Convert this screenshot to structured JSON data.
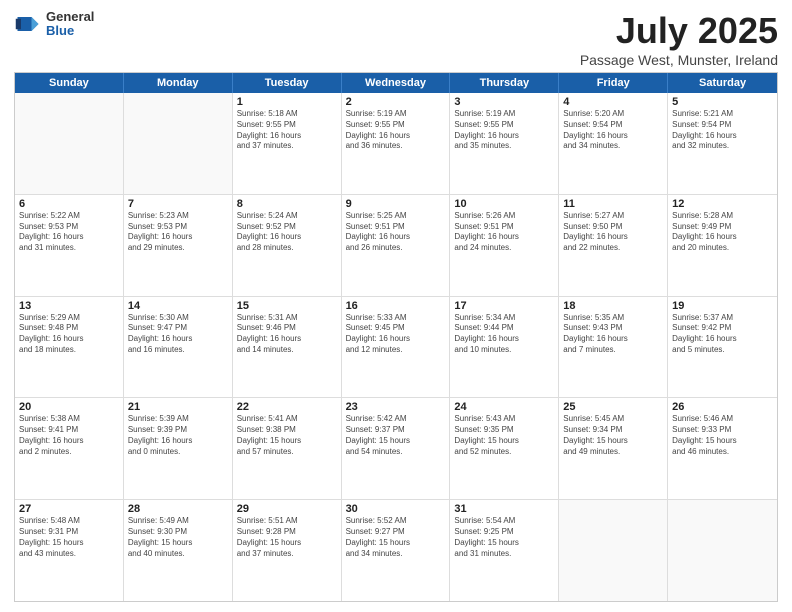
{
  "header": {
    "logo": {
      "general": "General",
      "blue": "Blue"
    },
    "title": "July 2025",
    "subtitle": "Passage West, Munster, Ireland"
  },
  "calendar": {
    "days": [
      "Sunday",
      "Monday",
      "Tuesday",
      "Wednesday",
      "Thursday",
      "Friday",
      "Saturday"
    ],
    "rows": [
      [
        {
          "num": "",
          "content": ""
        },
        {
          "num": "",
          "content": ""
        },
        {
          "num": "1",
          "content": "Sunrise: 5:18 AM\nSunset: 9:55 PM\nDaylight: 16 hours\nand 37 minutes."
        },
        {
          "num": "2",
          "content": "Sunrise: 5:19 AM\nSunset: 9:55 PM\nDaylight: 16 hours\nand 36 minutes."
        },
        {
          "num": "3",
          "content": "Sunrise: 5:19 AM\nSunset: 9:55 PM\nDaylight: 16 hours\nand 35 minutes."
        },
        {
          "num": "4",
          "content": "Sunrise: 5:20 AM\nSunset: 9:54 PM\nDaylight: 16 hours\nand 34 minutes."
        },
        {
          "num": "5",
          "content": "Sunrise: 5:21 AM\nSunset: 9:54 PM\nDaylight: 16 hours\nand 32 minutes."
        }
      ],
      [
        {
          "num": "6",
          "content": "Sunrise: 5:22 AM\nSunset: 9:53 PM\nDaylight: 16 hours\nand 31 minutes."
        },
        {
          "num": "7",
          "content": "Sunrise: 5:23 AM\nSunset: 9:53 PM\nDaylight: 16 hours\nand 29 minutes."
        },
        {
          "num": "8",
          "content": "Sunrise: 5:24 AM\nSunset: 9:52 PM\nDaylight: 16 hours\nand 28 minutes."
        },
        {
          "num": "9",
          "content": "Sunrise: 5:25 AM\nSunset: 9:51 PM\nDaylight: 16 hours\nand 26 minutes."
        },
        {
          "num": "10",
          "content": "Sunrise: 5:26 AM\nSunset: 9:51 PM\nDaylight: 16 hours\nand 24 minutes."
        },
        {
          "num": "11",
          "content": "Sunrise: 5:27 AM\nSunset: 9:50 PM\nDaylight: 16 hours\nand 22 minutes."
        },
        {
          "num": "12",
          "content": "Sunrise: 5:28 AM\nSunset: 9:49 PM\nDaylight: 16 hours\nand 20 minutes."
        }
      ],
      [
        {
          "num": "13",
          "content": "Sunrise: 5:29 AM\nSunset: 9:48 PM\nDaylight: 16 hours\nand 18 minutes."
        },
        {
          "num": "14",
          "content": "Sunrise: 5:30 AM\nSunset: 9:47 PM\nDaylight: 16 hours\nand 16 minutes."
        },
        {
          "num": "15",
          "content": "Sunrise: 5:31 AM\nSunset: 9:46 PM\nDaylight: 16 hours\nand 14 minutes."
        },
        {
          "num": "16",
          "content": "Sunrise: 5:33 AM\nSunset: 9:45 PM\nDaylight: 16 hours\nand 12 minutes."
        },
        {
          "num": "17",
          "content": "Sunrise: 5:34 AM\nSunset: 9:44 PM\nDaylight: 16 hours\nand 10 minutes."
        },
        {
          "num": "18",
          "content": "Sunrise: 5:35 AM\nSunset: 9:43 PM\nDaylight: 16 hours\nand 7 minutes."
        },
        {
          "num": "19",
          "content": "Sunrise: 5:37 AM\nSunset: 9:42 PM\nDaylight: 16 hours\nand 5 minutes."
        }
      ],
      [
        {
          "num": "20",
          "content": "Sunrise: 5:38 AM\nSunset: 9:41 PM\nDaylight: 16 hours\nand 2 minutes."
        },
        {
          "num": "21",
          "content": "Sunrise: 5:39 AM\nSunset: 9:39 PM\nDaylight: 16 hours\nand 0 minutes."
        },
        {
          "num": "22",
          "content": "Sunrise: 5:41 AM\nSunset: 9:38 PM\nDaylight: 15 hours\nand 57 minutes."
        },
        {
          "num": "23",
          "content": "Sunrise: 5:42 AM\nSunset: 9:37 PM\nDaylight: 15 hours\nand 54 minutes."
        },
        {
          "num": "24",
          "content": "Sunrise: 5:43 AM\nSunset: 9:35 PM\nDaylight: 15 hours\nand 52 minutes."
        },
        {
          "num": "25",
          "content": "Sunrise: 5:45 AM\nSunset: 9:34 PM\nDaylight: 15 hours\nand 49 minutes."
        },
        {
          "num": "26",
          "content": "Sunrise: 5:46 AM\nSunset: 9:33 PM\nDaylight: 15 hours\nand 46 minutes."
        }
      ],
      [
        {
          "num": "27",
          "content": "Sunrise: 5:48 AM\nSunset: 9:31 PM\nDaylight: 15 hours\nand 43 minutes."
        },
        {
          "num": "28",
          "content": "Sunrise: 5:49 AM\nSunset: 9:30 PM\nDaylight: 15 hours\nand 40 minutes."
        },
        {
          "num": "29",
          "content": "Sunrise: 5:51 AM\nSunset: 9:28 PM\nDaylight: 15 hours\nand 37 minutes."
        },
        {
          "num": "30",
          "content": "Sunrise: 5:52 AM\nSunset: 9:27 PM\nDaylight: 15 hours\nand 34 minutes."
        },
        {
          "num": "31",
          "content": "Sunrise: 5:54 AM\nSunset: 9:25 PM\nDaylight: 15 hours\nand 31 minutes."
        },
        {
          "num": "",
          "content": ""
        },
        {
          "num": "",
          "content": ""
        }
      ]
    ]
  }
}
